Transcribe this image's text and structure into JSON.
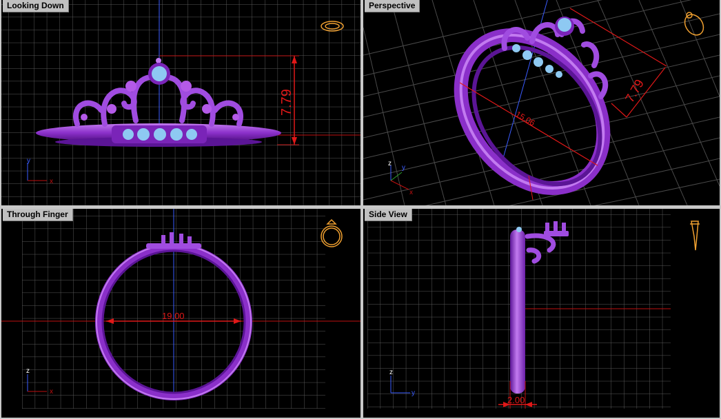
{
  "viewports": {
    "top_left": {
      "title": "Looking Down",
      "dimension": "7.79",
      "axes": [
        "y",
        "x"
      ]
    },
    "top_right": {
      "title": "Perspective",
      "dimensions": [
        "7.79",
        "15.06"
      ],
      "axes": [
        "z",
        "y",
        "x"
      ]
    },
    "bottom_left": {
      "title": "Through Finger",
      "dimension": "19.00",
      "axes": [
        "z",
        "x"
      ]
    },
    "bottom_right": {
      "title": "Side View",
      "dimension": "2.00",
      "axes": [
        "z",
        "y"
      ]
    }
  },
  "colors": {
    "background": "#000000",
    "grid": "#5a5a5a",
    "ring_metal": "#8a2fc9",
    "ring_highlight": "#c27af0",
    "gem": "#8ec9f2",
    "dimension": "#e01818",
    "axis_blue": "#3a5cff",
    "view_cube": "#f0a030"
  }
}
